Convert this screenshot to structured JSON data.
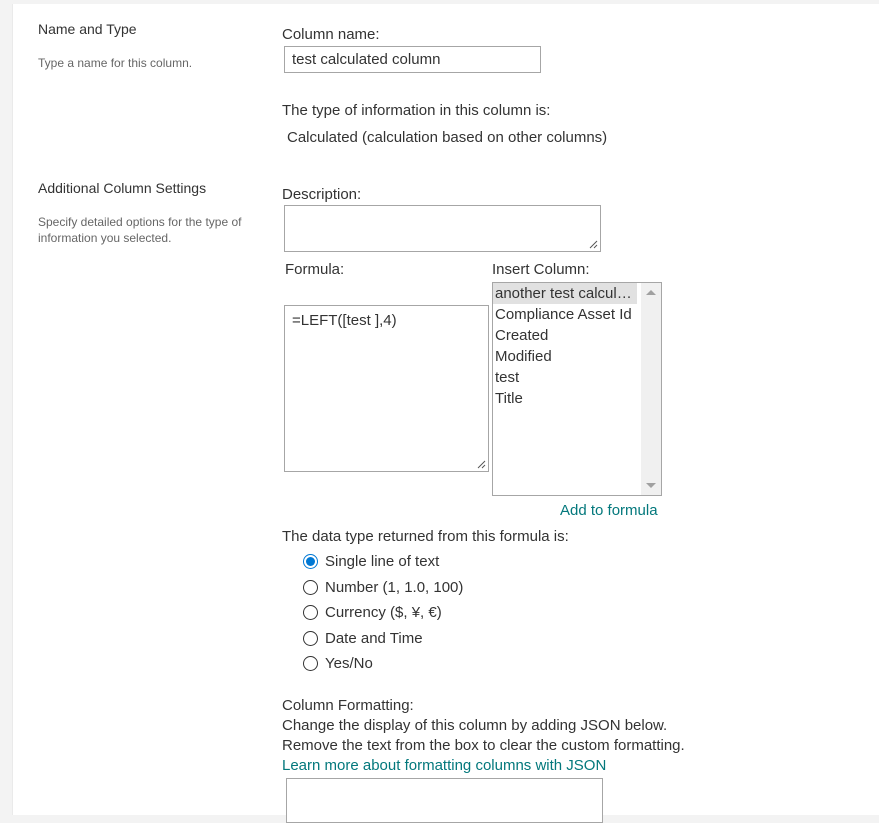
{
  "name_and_type": {
    "title": "Name and Type",
    "description": "Type a name for this column."
  },
  "column_name": {
    "label": "Column name:",
    "value": "test calculated column"
  },
  "type_info": {
    "label": "The type of information in this column is:",
    "value": "Calculated (calculation based on other columns)"
  },
  "additional_settings": {
    "title": "Additional Column Settings",
    "description": "Specify detailed options for the type of information you selected."
  },
  "description_field": {
    "label": "Description:",
    "value": ""
  },
  "formula": {
    "label": "Formula:",
    "value": "=LEFT([test ],4)"
  },
  "insert_column": {
    "label": "Insert Column:",
    "items": [
      "another test calculated column",
      "Compliance Asset Id",
      "Created",
      "Modified",
      "test",
      "Title"
    ],
    "selected_index": 0,
    "add_link": "Add to formula"
  },
  "return_type": {
    "label": "The data type returned from this formula is:",
    "options": [
      "Single line of text",
      "Number (1, 1.0, 100)",
      "Currency ($, ¥, €)",
      "Date and Time",
      "Yes/No"
    ],
    "selected_index": 0
  },
  "column_formatting": {
    "title": "Column Formatting:",
    "line1": "Change the display of this column by adding JSON below.",
    "line2": "Remove the text from the box to clear the custom formatting.",
    "learn_more_link": "Learn more about formatting columns with JSON",
    "value": ""
  },
  "colors": {
    "accent": "#0078d4",
    "link": "#03787c",
    "selected_item_bg": "#e1e1e1"
  }
}
